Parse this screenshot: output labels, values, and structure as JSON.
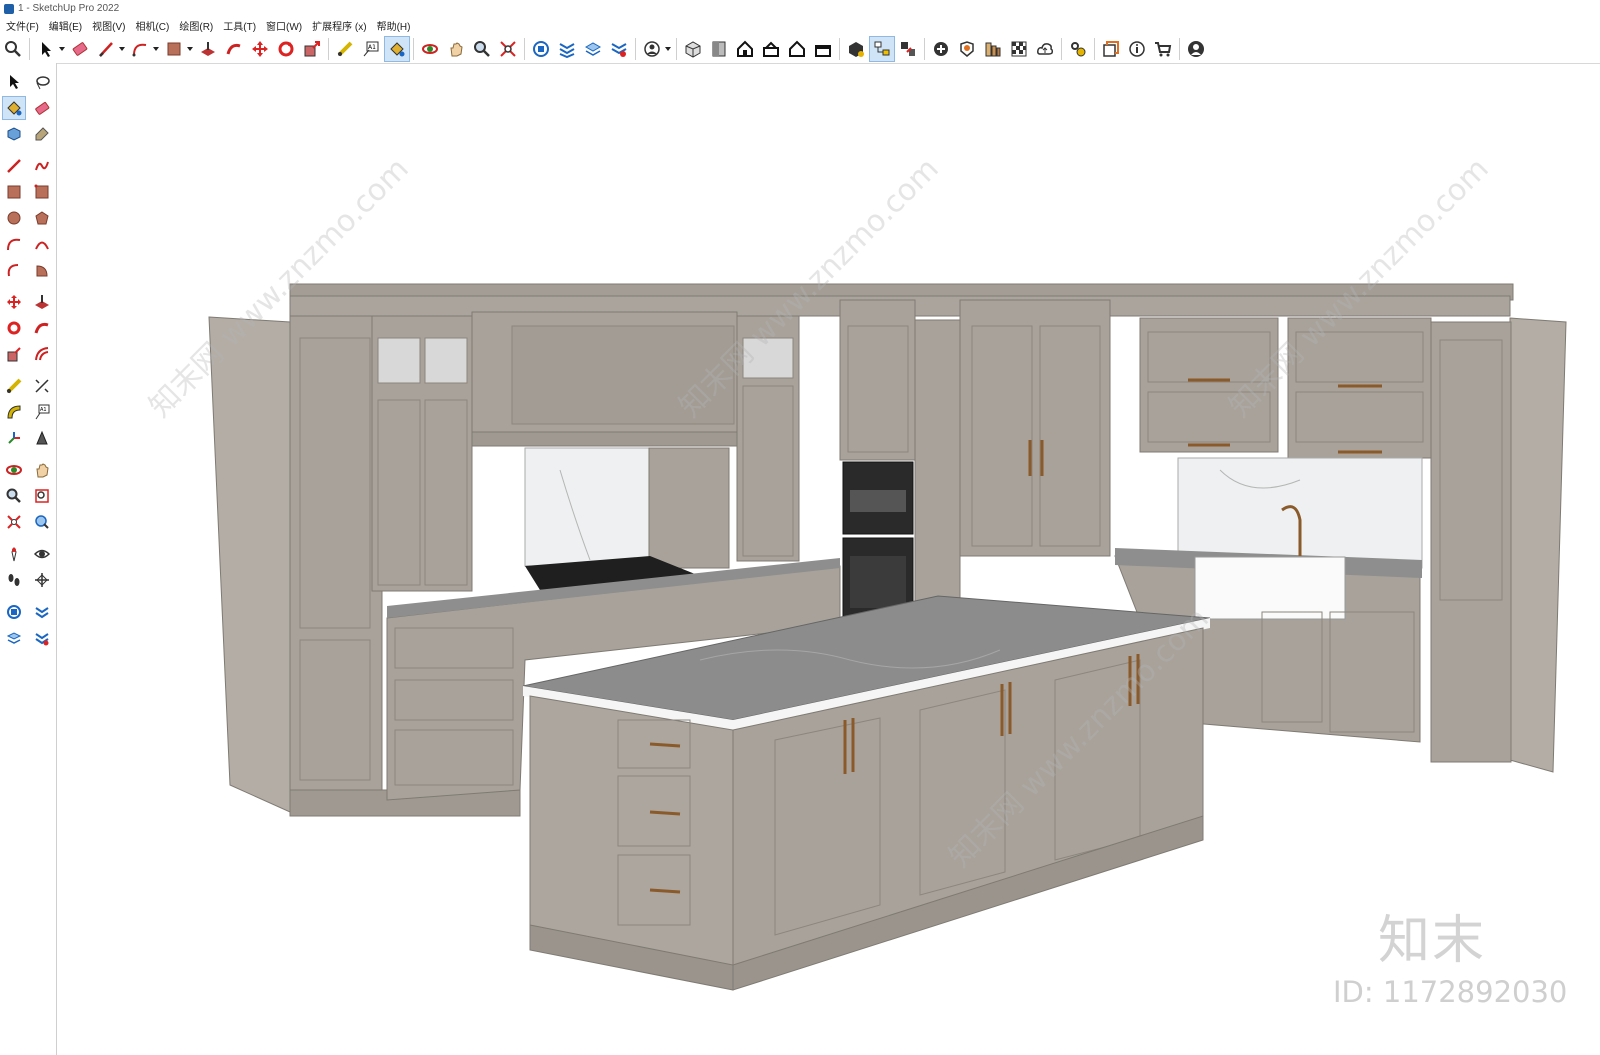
{
  "window": {
    "title": "1 - SketchUp Pro 2022"
  },
  "menu": [
    {
      "label": "文件(F)"
    },
    {
      "label": "编辑(E)"
    },
    {
      "label": "视图(V)"
    },
    {
      "label": "相机(C)"
    },
    {
      "label": "绘图(R)"
    },
    {
      "label": "工具(T)"
    },
    {
      "label": "窗口(W)"
    },
    {
      "label": "扩展程序 (x)"
    },
    {
      "label": "帮助(H)"
    }
  ],
  "colors": {
    "cabinet": "#a8a29a",
    "cabinet_dark": "#8f8a83",
    "cabinet_side": "#b5afa7",
    "countertop": "#8e8e8e",
    "active_tool": "#cfe4f7"
  },
  "watermark": {
    "logo": "知末",
    "id": "ID: 1172892030",
    "diagonal": "知末网 www.znzmo.com"
  }
}
